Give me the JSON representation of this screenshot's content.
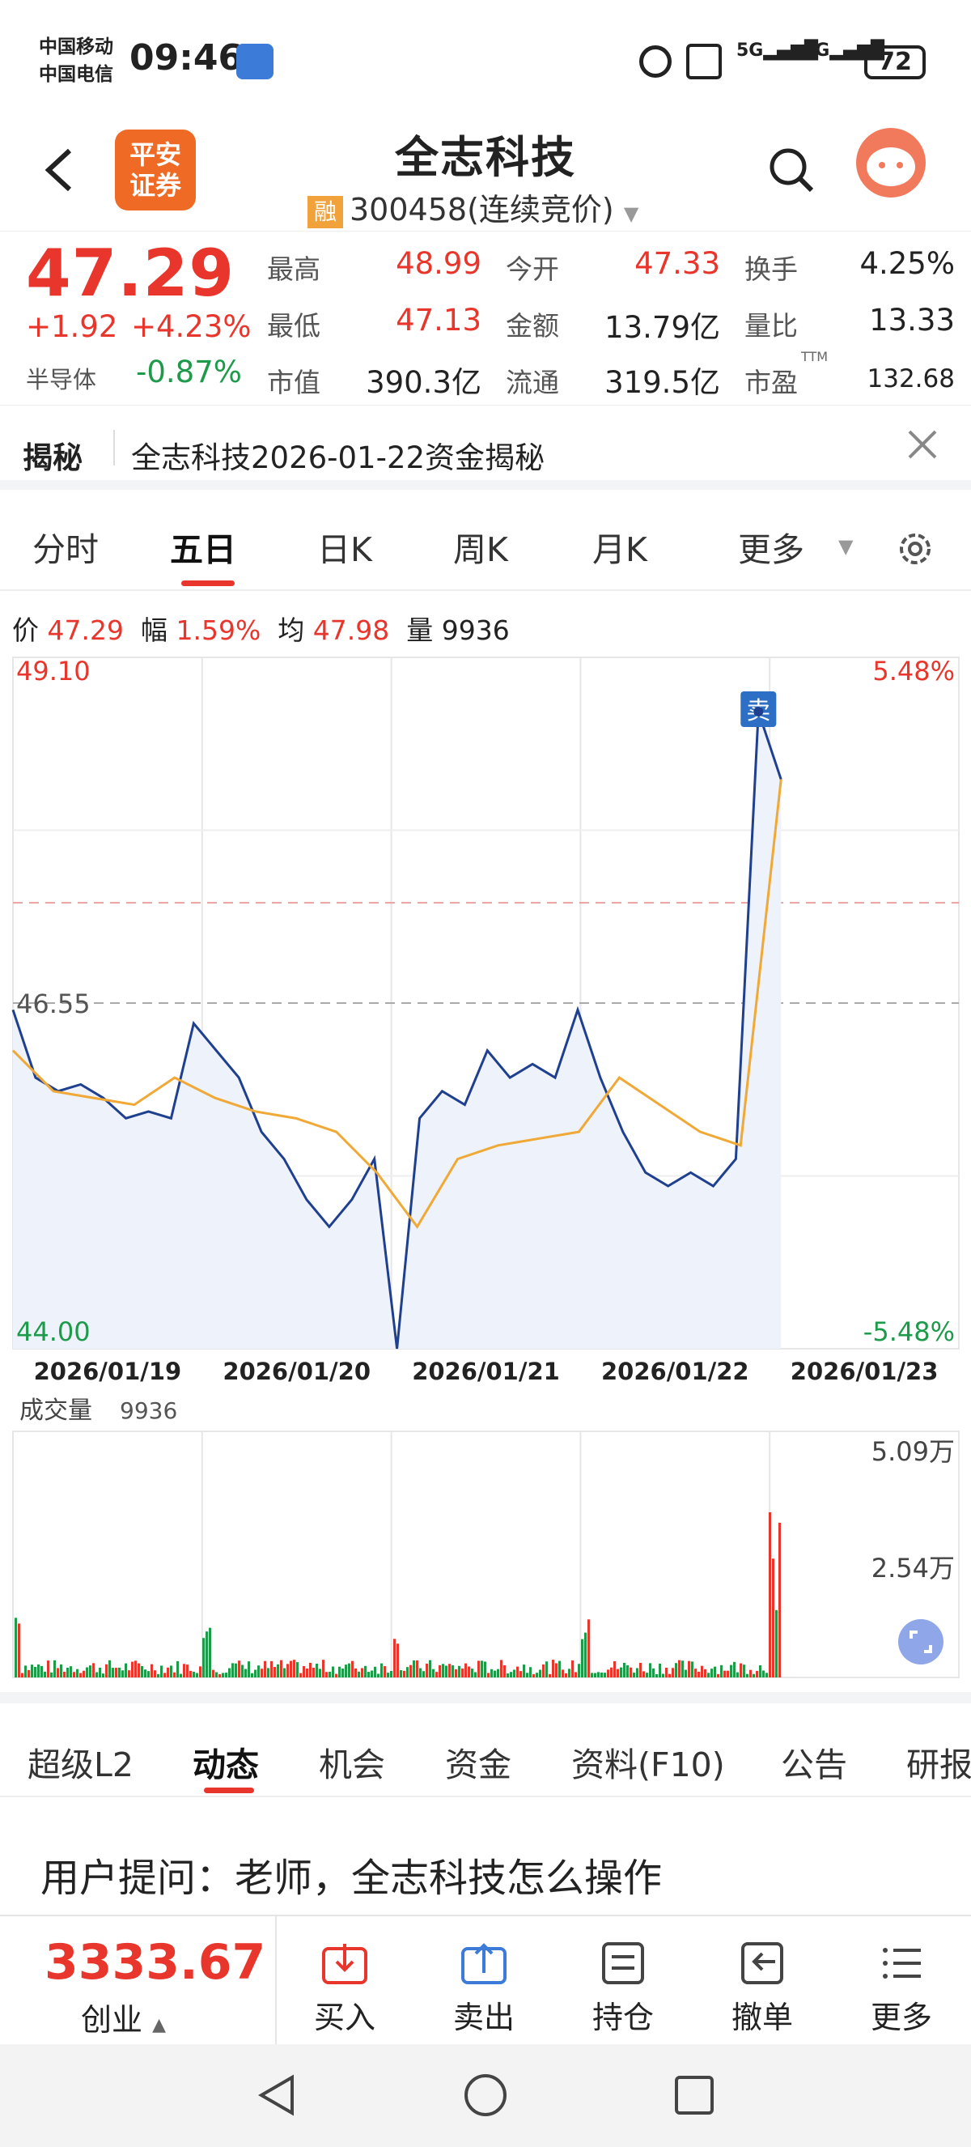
{
  "status": {
    "carrier1": "中国移动",
    "carrier2": "中国电信",
    "time": "09:46",
    "battery": "72"
  },
  "header": {
    "logo_line1": "平安",
    "logo_line2": "证券",
    "title": "全志科技",
    "badge": "融",
    "code": "300458",
    "market_status": "(连续竞价)"
  },
  "quote": {
    "price": "47.29",
    "change": "+1.92",
    "change_pct": "+4.23%",
    "sector_label": "半导体",
    "sector_pct": "-0.87%",
    "fields": [
      {
        "label": "最高",
        "value": "48.99"
      },
      {
        "label": "今开",
        "value": "47.33"
      },
      {
        "label": "换手",
        "value": "4.25%"
      },
      {
        "label": "最低",
        "value": "47.13"
      },
      {
        "label": "金额",
        "value": "13.79亿"
      },
      {
        "label": "量比",
        "value": "13.33"
      },
      {
        "label": "市值",
        "value": "390.3亿"
      },
      {
        "label": "流通",
        "value": "319.5亿"
      },
      {
        "label": "市盈",
        "value": "132.68"
      }
    ],
    "ttm": "TTM"
  },
  "reveal": {
    "label": "揭秘",
    "text": "全志科技2026-01-22资金揭秘"
  },
  "chart_tabs": [
    "分时",
    "五日",
    "日K",
    "周K",
    "月K",
    "更多"
  ],
  "info_line": {
    "price_label": "价",
    "price": "47.29",
    "amp_label": "幅",
    "amp": "1.59%",
    "avg_label": "均",
    "avg": "47.98",
    "vol_label": "量",
    "vol": "9936"
  },
  "chart_data": {
    "type": "line",
    "title": "",
    "x": [
      "2026/01/19",
      "2026/01/20",
      "2026/01/21",
      "2026/01/22",
      "2026/01/23"
    ],
    "ylim": [
      44.0,
      49.1
    ],
    "y_left_labels": [
      "49.10",
      "46.55",
      "44.00"
    ],
    "y_right_labels": [
      "5.48%",
      "-5.48%"
    ],
    "prev_close": 46.55,
    "series": [
      {
        "values": [
          46.5,
          46.0,
          45.9,
          45.95,
          45.85,
          45.7,
          45.75,
          45.7,
          46.4,
          46.2,
          46.0,
          45.6,
          45.4,
          45.1,
          44.9,
          45.1,
          45.4,
          44.0,
          45.7,
          45.9,
          45.8,
          46.2,
          46.0,
          46.1,
          46.0,
          46.5,
          46.0,
          45.6,
          45.3,
          45.2,
          45.3,
          45.2,
          45.4,
          48.7,
          48.2
        ]
      },
      {
        "values": [
          46.2,
          45.9,
          45.85,
          45.8,
          46.0,
          45.85,
          45.75,
          45.7,
          45.6,
          45.3,
          44.9,
          45.4,
          45.5,
          45.55,
          45.6,
          46.0,
          45.8,
          45.6,
          45.5,
          48.2
        ]
      }
    ],
    "marker": "卖",
    "volume": {
      "label": "成交量",
      "value": "9936",
      "ylim_labels": [
        "5.09万",
        "2.54万"
      ],
      "peak": 50900
    }
  },
  "section_tabs": [
    "超级L2",
    "动态",
    "机会",
    "资金",
    "资料(F10)",
    "公告",
    "研报"
  ],
  "question": "用户提问：老师，全志科技怎么操作",
  "toolbar": {
    "index_value": "3333.67",
    "index_name": "创业",
    "buttons": [
      "买入",
      "卖出",
      "持仓",
      "撤单",
      "更多"
    ]
  },
  "colors": {
    "red": "#e8362c",
    "green": "#1e9a4b",
    "price_line": "#1f3f8f",
    "avg_line": "#f0a836",
    "accent": "#e8362c"
  }
}
